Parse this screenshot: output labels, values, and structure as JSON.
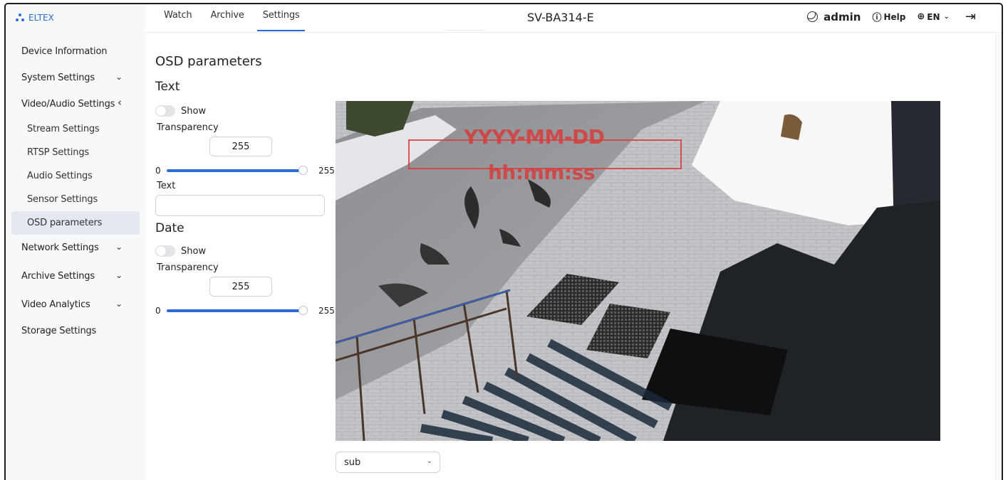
{
  "brand": {
    "name": "ELTEX"
  },
  "header": {
    "tabs": [
      {
        "label": "Watch"
      },
      {
        "label": "Archive"
      },
      {
        "label": "Settings"
      }
    ],
    "device_title": "SV-BA314-E",
    "user": "admin",
    "help_label": "Help",
    "lang_label": "EN",
    "theme_icon": "moon-icon",
    "logout_icon": "logout-icon"
  },
  "sidebar": {
    "items": [
      {
        "label": "Device Information"
      },
      {
        "label": "System Settings",
        "chevron": "⌄"
      },
      {
        "label": "Video/Audio Settings",
        "chevron": "‹"
      },
      {
        "label": "Stream Settings"
      },
      {
        "label": "RTSP Settings"
      },
      {
        "label": "Audio Settings"
      },
      {
        "label": "Sensor Settings"
      },
      {
        "label": "OSD parameters"
      },
      {
        "label": "Network Settings",
        "chevron": "⌄"
      },
      {
        "label": "Archive Settings",
        "chevron": "⌄"
      },
      {
        "label": "Video Analytics",
        "chevron": "⌄"
      },
      {
        "label": "Storage Settings"
      }
    ]
  },
  "main": {
    "title": "OSD parameters",
    "text_section": {
      "title": "Text",
      "show_label": "Show",
      "transparency_label": "Transparency",
      "transparency_value": "255",
      "slider_min": "0",
      "slider_max": "255",
      "text_label": "Text",
      "text_value": ""
    },
    "date_section": {
      "title": "Date",
      "show_label": "Show",
      "transparency_label": "Transparency",
      "transparency_value": "255",
      "slider_min": "0",
      "slider_max": "255"
    },
    "overlay": {
      "date_format": "YYYY-MM-DD",
      "time_format": "hh:mm:ss",
      "color": "#d63c3c"
    },
    "stream_select": {
      "value": "sub"
    }
  },
  "colors": {
    "accent": "#2d6bd6",
    "sidebar_bg": "#f7f8fa",
    "active_bg": "#e4e9f1"
  }
}
